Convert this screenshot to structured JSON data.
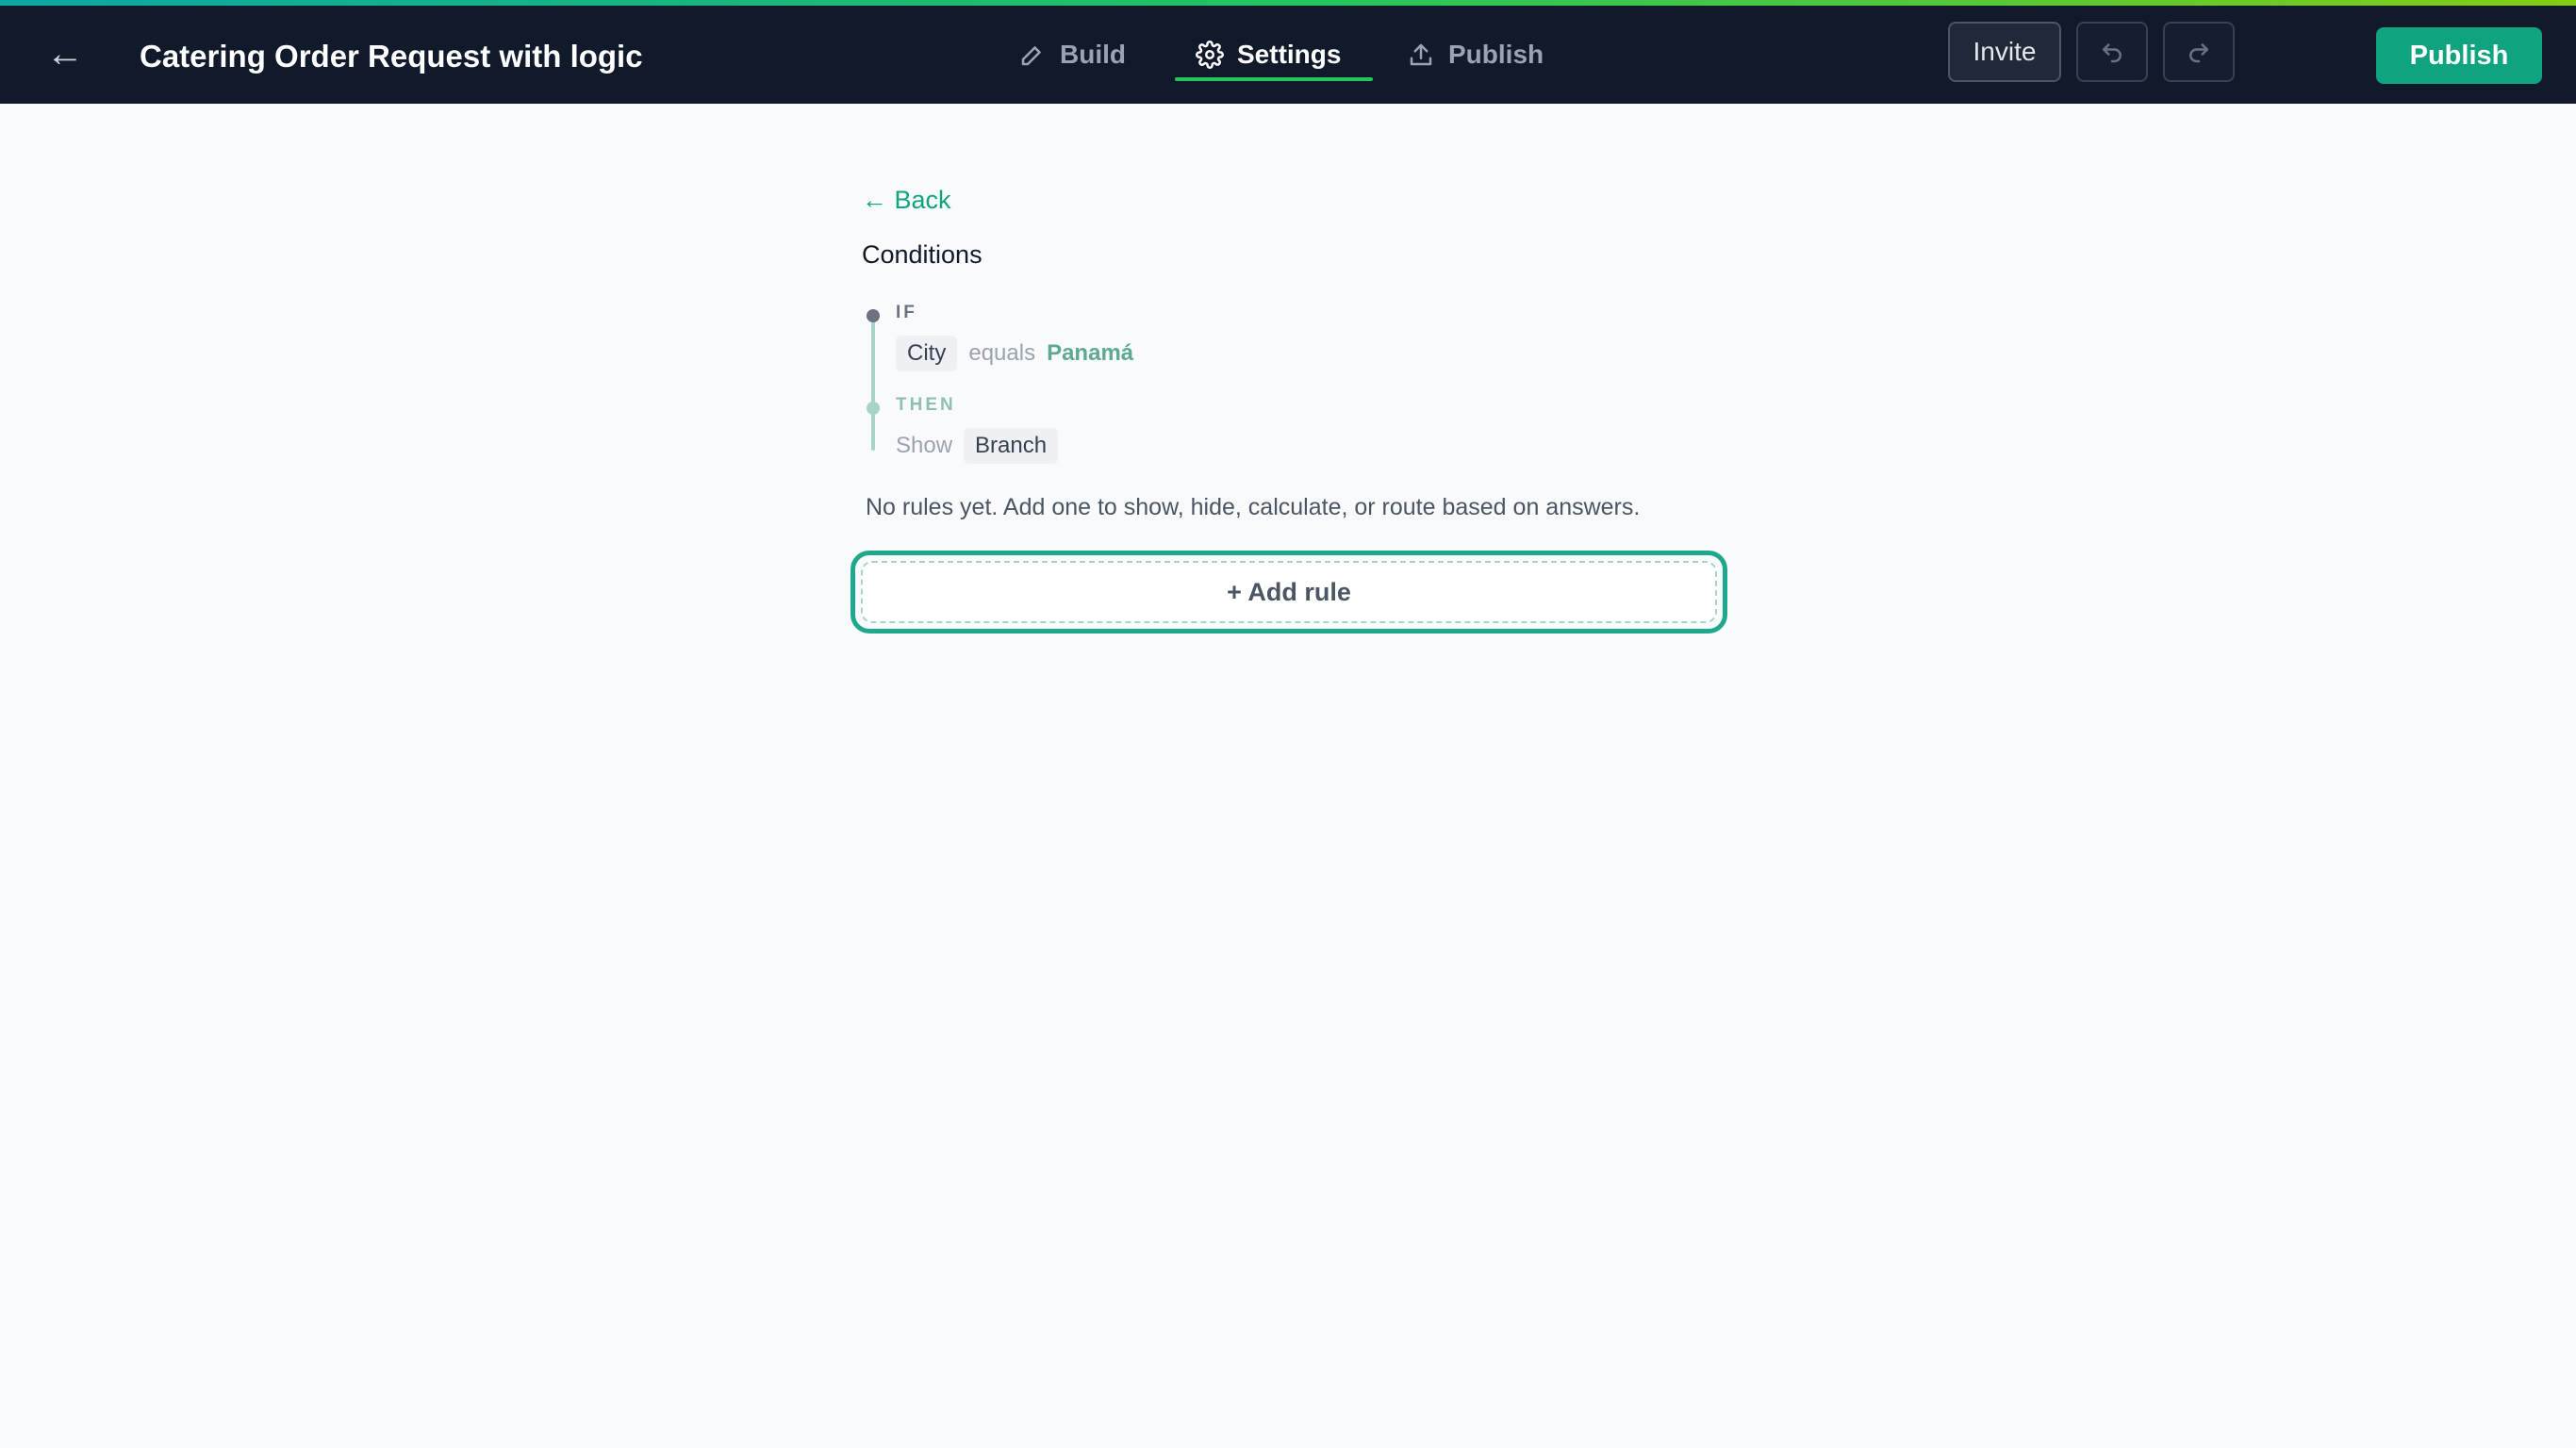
{
  "header": {
    "title": "Catering Order Request with logic",
    "tabs": [
      {
        "label": "Build",
        "icon": "pencil-icon",
        "active": false
      },
      {
        "label": "Settings",
        "icon": "gear-icon",
        "active": true
      },
      {
        "label": "Publish",
        "icon": "upload-icon",
        "active": false
      }
    ],
    "invite_label": "Invite",
    "publish_label": "Publish"
  },
  "logic": {
    "back_label": "← Back",
    "section_title": "Conditions",
    "if_label": "IF",
    "if_field": "City",
    "if_operator": "equals",
    "if_value": "Panamá",
    "then_label": "THEN",
    "then_action": "Show",
    "then_target": "Branch",
    "empty_message": "No rules yet. Add one to show, hide, calculate, or route based on answers.",
    "add_rule_label": "+ Add rule"
  },
  "colors": {
    "topbar": "#111a2b",
    "accent": "#10a37f",
    "tab_underline": "#22c55e",
    "background": "#f8fafc"
  }
}
